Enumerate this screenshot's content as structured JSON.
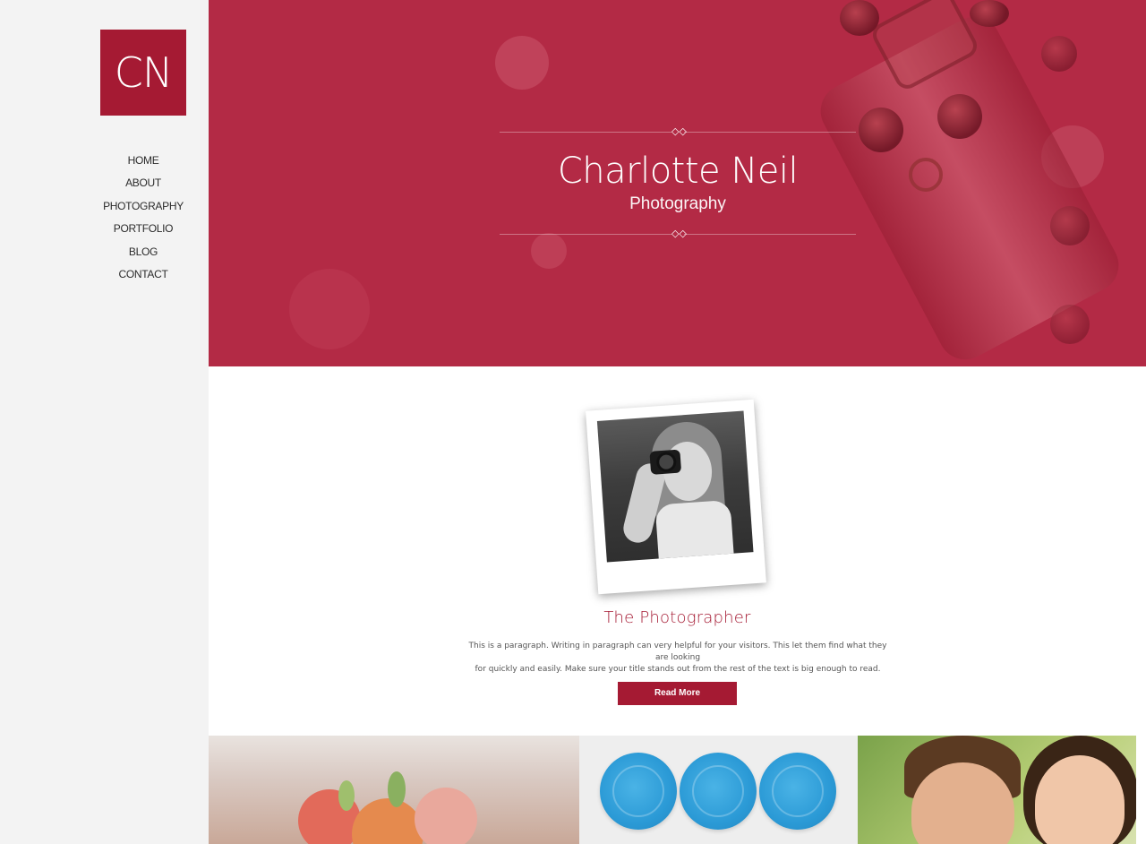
{
  "colors": {
    "accent": "#a51a33",
    "hero_overlay": "#b32a45",
    "sidebar_bg": "#f3f3f3"
  },
  "logo": {
    "text": "CN"
  },
  "nav": {
    "items": [
      {
        "label": "HOME"
      },
      {
        "label": "ABOUT"
      },
      {
        "label": "PHOTOGRAPHY"
      },
      {
        "label": "PORTFOLIO"
      },
      {
        "label": "BLOG"
      },
      {
        "label": "CONTACT"
      }
    ]
  },
  "hero": {
    "title": "Charlotte Neil",
    "subtitle": "Photography",
    "divider_icon": "double-diamond-icon"
  },
  "about": {
    "title": "The Photographer",
    "paragraph_line1": "This is a paragraph. Writing in paragraph can very helpful for your visitors. This let them find what they are looking",
    "paragraph_line2": "for quickly and easily. Make sure your title stands out from the rest of the text is big enough to read.",
    "button_label": "Read More"
  }
}
